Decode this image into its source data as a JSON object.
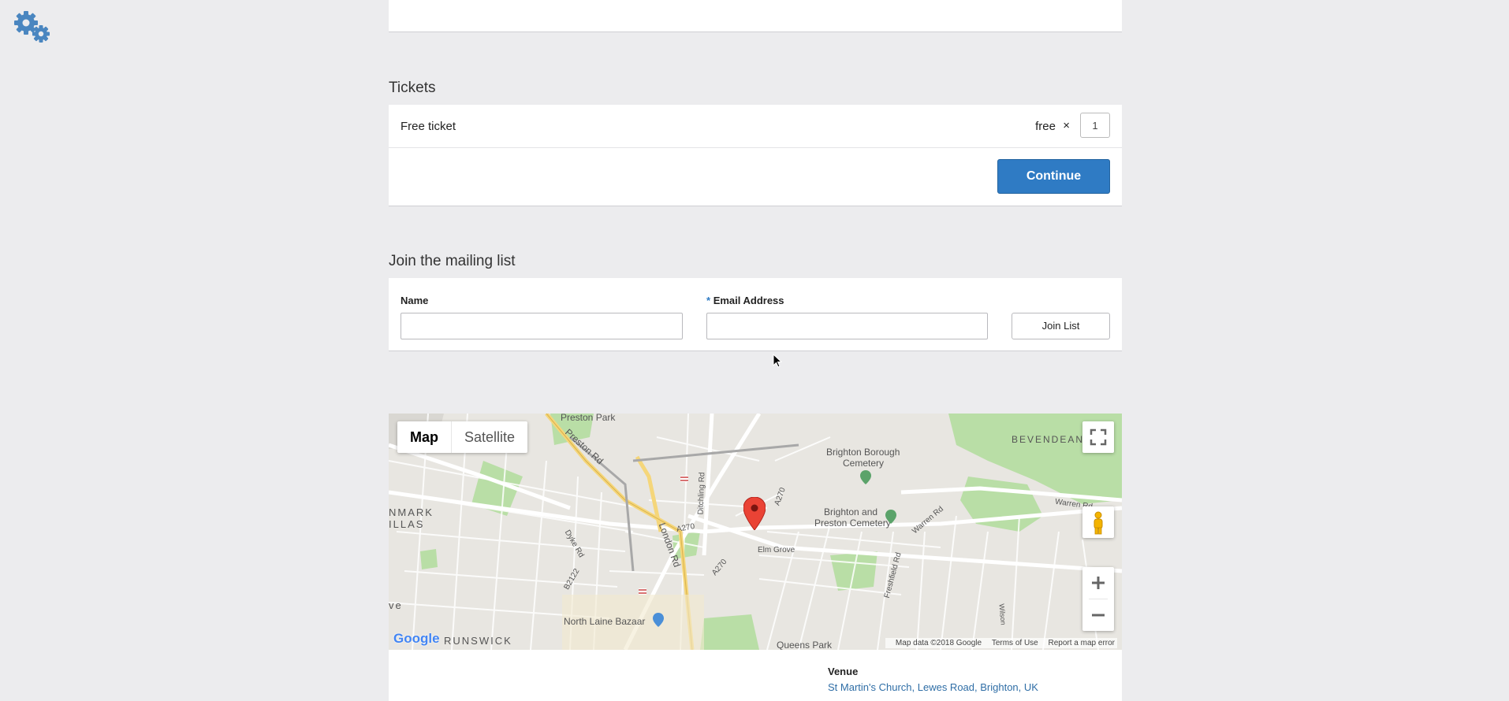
{
  "app": {
    "settings_icon": "gears-icon",
    "accent_color": "#2f7bc4"
  },
  "tickets": {
    "title": "Tickets",
    "items": [
      {
        "name": "Free ticket",
        "price": "free",
        "times": "×",
        "quantity": "1"
      }
    ],
    "continue_label": "Continue"
  },
  "mailing": {
    "title": "Join the mailing list",
    "name_label": "Name",
    "email_required": "*",
    "email_label": "Email Address",
    "join_label": "Join List"
  },
  "map": {
    "type_map": "Map",
    "type_satellite": "Satellite",
    "labels": {
      "preston_park": "Preston Park",
      "preston_rd": "Preston Rd",
      "brighton_borough_cemetery_1": "Brighton Borough",
      "brighton_borough_cemetery_2": "Cemetery",
      "bevendean": "BEVENDEAN",
      "preston_cemetery_1": "Brighton and",
      "preston_cemetery_2": "Preston Cemetery",
      "ditchling_rd": "Ditchling Rd",
      "london_rd": "London Rd",
      "elm_grove": "Elm Grove",
      "warren_rd": "Warren Rd",
      "warren_rd_2": "Warren Rd",
      "a270_1": "A270",
      "a270_2": "A270",
      "a270_3": "A270",
      "dyke_rd": "Dyke Rd",
      "b2122": "B2122",
      "freshfield_rd": "Freshfield Rd",
      "north_laine": "North Laine Bazaar",
      "brunswick": "RUNSWICK",
      "queens_park": "Queens Park",
      "nmark": "NMARK",
      "illas": "ILLAS",
      "ve": "ve",
      "wilson": "Wilson"
    },
    "google_logo": "Google",
    "attribution_data": "Map data ©2018 Google",
    "attribution_terms": "Terms of Use",
    "attribution_report": "Report a map error"
  },
  "venue": {
    "heading": "Venue",
    "address": "St Martin's Church, Lewes Road, Brighton, UK"
  }
}
